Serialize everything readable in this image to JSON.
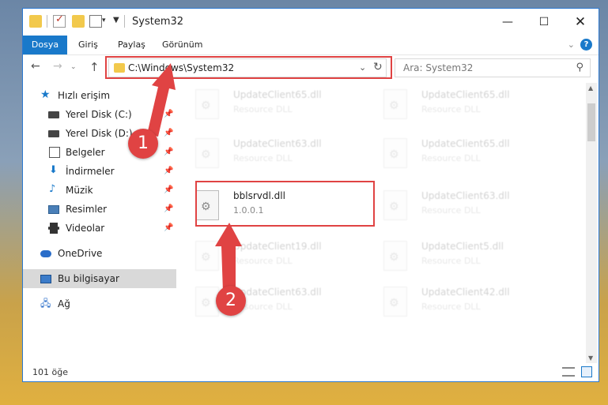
{
  "window": {
    "title": "System32"
  },
  "ribbon": {
    "tabs": [
      "Dosya",
      "Giriş",
      "Paylaş",
      "Görünüm"
    ],
    "help": "?"
  },
  "navigation": {
    "address_path": "C:\\Windows\\System32",
    "search_placeholder": "Ara: System32"
  },
  "sidebar": {
    "items": [
      {
        "label": "Hızlı erişim",
        "icon": "star-icon",
        "pinned": false
      },
      {
        "label": "Yerel Disk (C:)",
        "icon": "drive-icon",
        "pinned": true
      },
      {
        "label": "Yerel Disk (D:)",
        "icon": "drive-icon",
        "pinned": true
      },
      {
        "label": "Belgeler",
        "icon": "document-icon",
        "pinned": true
      },
      {
        "label": "İndirmeler",
        "icon": "download-icon",
        "pinned": true
      },
      {
        "label": "Müzik",
        "icon": "music-icon",
        "pinned": true
      },
      {
        "label": "Resimler",
        "icon": "picture-icon",
        "pinned": true
      },
      {
        "label": "Videolar",
        "icon": "video-icon",
        "pinned": true
      },
      {
        "label": "OneDrive",
        "icon": "cloud-icon",
        "pinned": false
      },
      {
        "label": "Bu bilgisayar",
        "icon": "computer-icon",
        "pinned": false,
        "selected": true
      },
      {
        "label": "Ağ",
        "icon": "network-icon",
        "pinned": false
      }
    ]
  },
  "files": [
    {
      "name": "UpdateClient65.dll",
      "sub": "Resource DLL",
      "faded": true
    },
    {
      "name": "UpdateClient65.dll",
      "sub": "Resource DLL",
      "faded": true
    },
    {
      "name": "UpdateClient63.dll",
      "sub": "Resource DLL",
      "faded": true
    },
    {
      "name": "UpdateClient65.dll",
      "sub": "Resource DLL",
      "faded": true
    },
    {
      "name": "bblsrvdl.dll",
      "sub": "1.0.0.1",
      "faded": false
    },
    {
      "name": "UpdateClient63.dll",
      "sub": "Resource DLL",
      "faded": true
    },
    {
      "name": "UpdateClient19.dll",
      "sub": "Resource DLL",
      "faded": true
    },
    {
      "name": "UpdateClient5.dll",
      "sub": "Resource DLL",
      "faded": true
    },
    {
      "name": "UpdateClient63.dll",
      "sub": "Resource DLL",
      "faded": true
    },
    {
      "name": "UpdateClient42.dll",
      "sub": "Resource DLL",
      "faded": true
    }
  ],
  "status": {
    "item_count": "101 öğe"
  },
  "callouts": [
    "1",
    "2"
  ],
  "colors": {
    "accent": "#1979ca",
    "highlight": "#e04343"
  }
}
